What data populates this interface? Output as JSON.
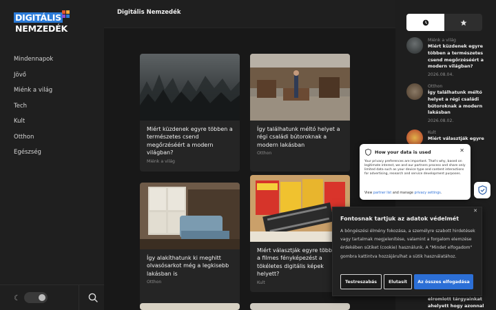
{
  "logo": {
    "line1": "DIGITÁLIS",
    "line2": "NEMZEDÉK",
    "colors": [
      "#e4572e",
      "#f2a93b",
      "#2b7bd8",
      "#8a4fd1"
    ]
  },
  "sidebar": {
    "items": [
      {
        "label": "Mindennapok"
      },
      {
        "label": "Jövő"
      },
      {
        "label": "Miénk a világ"
      },
      {
        "label": "Tech"
      },
      {
        "label": "Kult"
      },
      {
        "label": "Otthon"
      },
      {
        "label": "Egészség"
      }
    ],
    "theme_toggle": {
      "icon": "moon-icon",
      "state": "dark"
    },
    "search_icon": "search-icon"
  },
  "header": {
    "title": "Digitális Nemzedék"
  },
  "articles": [
    {
      "title": "Miért küzdenek egyre többen a természetes csend megőrzéséért a modern világban?",
      "category": "Miénk a világ",
      "image": "foggy-forest"
    },
    {
      "title": "Így találhatunk méltó helyet a régi családi bútoroknak a modern lakásban",
      "category": "Otthon",
      "image": "antique-furniture-shop"
    },
    {
      "title": "Így alakíthatunk ki meghitt olvasósarkot még a legkisebb lakásban is",
      "category": "Otthon",
      "image": "window-armchair"
    },
    {
      "title": "Miért választják egyre többen a filmes fényképezést a tökéletes digitális képek helyett?",
      "category": "Kult",
      "image": "film-rolls"
    }
  ],
  "rail": {
    "tabs": [
      {
        "icon": "clock-icon",
        "active": true
      },
      {
        "icon": "star-icon",
        "active": false
      }
    ],
    "items": [
      {
        "category": "Miénk a világ",
        "title": "Miért küzdenek egyre többen a természetes csend megőrzéséért a modern világban?",
        "date": "2026.08.04."
      },
      {
        "category": "Otthon",
        "title": "Így találhatunk méltó helyet a régi családi bútoroknak a modern lakásban",
        "date": "2026.08.02."
      },
      {
        "category": "Kult",
        "title": "Miért választják egyre",
        "date": ""
      }
    ],
    "partial_bottom": "elromlott tárgyainkat ahelyett hogy azonnal"
  },
  "privacy": {
    "title": "How your data is used",
    "body": "Your privacy preferences are important. That's why, based on legitimate interest, we and our partners process and share only limited data such as your device type and content interactions for advertising, research and service development purposes.",
    "link_prefix": "View",
    "link1": "partner list",
    "link_mid": "and manage",
    "link2": "privacy settings",
    "link_suffix": "."
  },
  "cookie": {
    "title": "Fontosnak tartjuk az adatok védelmét",
    "body": "A böngészési élmény fokozása, a személyre szabott hirdetések vagy tartalmak megjelenítése, valamint a forgalom elemzése érdekében sütiket (cookie) használunk. A \"Mindet elfogadom\" gombra kattintva hozzájárulhat a sütik használatához.",
    "btn_settings": "Testreszabás",
    "btn_reject": "Elutasít",
    "btn_accept": "Az összes elfogadása",
    "accent": "#2c6fd6"
  }
}
